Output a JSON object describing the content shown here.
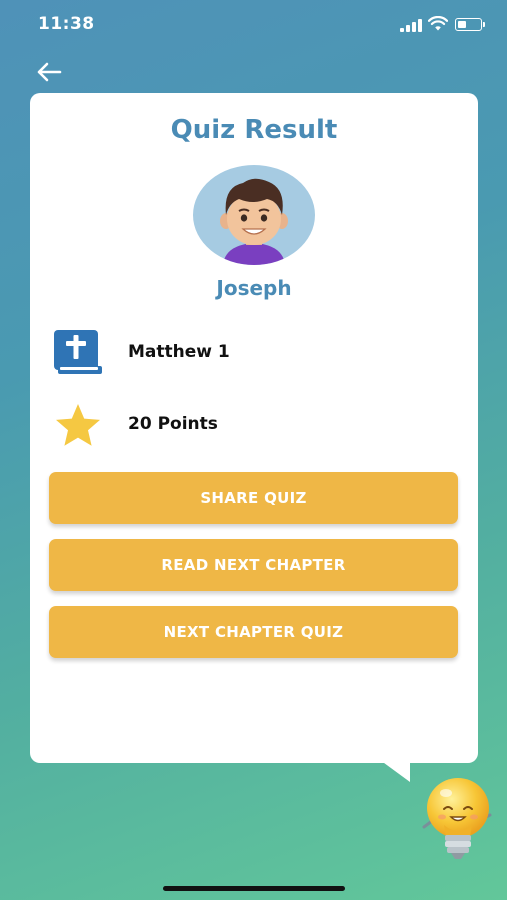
{
  "status_bar": {
    "time": "11:38",
    "icons": [
      "signal-icon",
      "wifi-icon",
      "battery-icon"
    ]
  },
  "header": {
    "back_icon": "arrow-left-icon"
  },
  "result": {
    "title": "Quiz Result",
    "user_name": "Joseph",
    "chapter": "Matthew 1",
    "chapter_icon": "bible-icon",
    "points": "20 Points",
    "points_icon": "star-icon"
  },
  "actions": {
    "share_label": "SHARE QUIZ",
    "read_next_label": "READ NEXT CHAPTER",
    "next_quiz_label": "NEXT CHAPTER QUIZ"
  },
  "colors": {
    "accent_blue": "#4a8bb5",
    "button_yellow": "#efb746",
    "star_yellow": "#f5c842",
    "bible_blue": "#2f74b5"
  }
}
